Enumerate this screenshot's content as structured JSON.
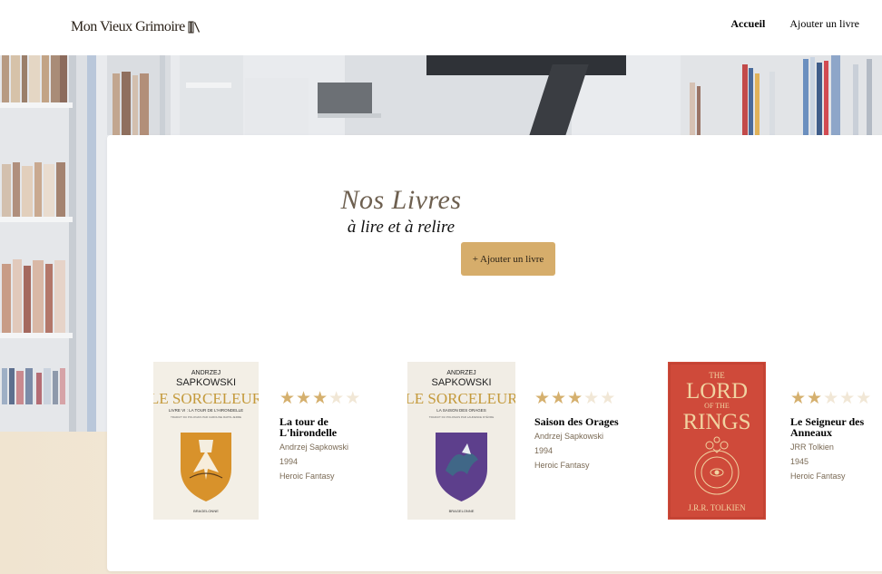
{
  "colors": {
    "accent": "#d6ad6b",
    "star_filled": "#d5b06e",
    "star_empty": "#f1e7d6",
    "title": "#6e6050",
    "beige": "#f3e8d8"
  },
  "header": {
    "logo_text": "Mon Vieux Grimoire",
    "logo_icon": "books-icon",
    "nav": [
      {
        "label": "Accueil",
        "active": true
      },
      {
        "label": "Ajouter un livre",
        "active": false
      }
    ]
  },
  "main": {
    "title": "Nos Livres",
    "subtitle": "à lire et à relire",
    "add_button": "+ Ajouter un livre"
  },
  "books": [
    {
      "title": "La tour de L'hirondelle",
      "author": "Andrzej Sapkowski",
      "year": "1994",
      "genre": "Heroic Fantasy",
      "rating": 3,
      "cover": {
        "author_line": "ANDRZEJ",
        "author_line2": "SAPKOWSKI",
        "series": "LE SORCELEUR",
        "subtitle": "LIVRE VI : LA TOUR DE L'HIRONDELLE",
        "translator": "TRADUIT DU POLONAIS PAR CAROLINE RAPIN-JERRE",
        "publisher": "BRAGELONNE"
      }
    },
    {
      "title": "Saison des Orages",
      "author": "Andrzej Sapkowski",
      "year": "1994",
      "genre": "Heroic Fantasy",
      "rating": 3,
      "cover": {
        "author_line": "ANDRZEJ",
        "author_line2": "SAPKOWSKI",
        "series": "LE SORCELEUR",
        "subtitle": "LA SAISON DES ORAGES",
        "translator": "TRADUIT DU POLONAIS PAR LAURENCE DYÈVRE",
        "publisher": "BRAGELONNE"
      }
    },
    {
      "title": "Le Seigneur des Anneaux",
      "author": "JRR Tolkien",
      "year": "1945",
      "genre": "Heroic Fantasy",
      "rating": 2,
      "cover": {
        "line1": "THE",
        "line2": "LORD",
        "line3": "OF THE",
        "line4": "RINGS",
        "author": "J.R.R. TOLKIEN"
      }
    }
  ]
}
